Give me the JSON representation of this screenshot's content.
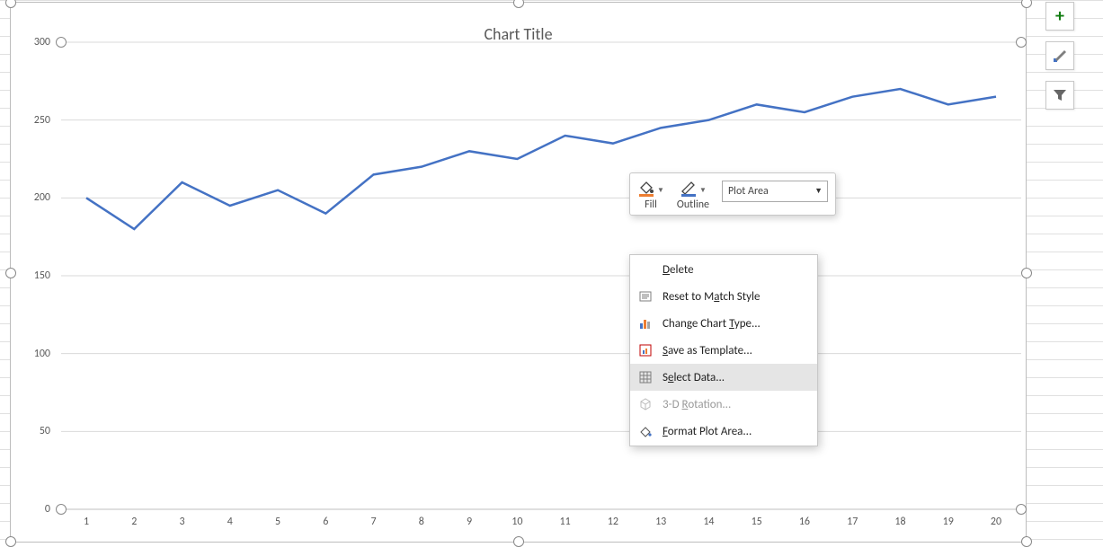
{
  "chart_data": {
    "type": "line",
    "title": "Chart Title",
    "xlabel": "",
    "ylabel": "",
    "ylim": [
      0,
      300
    ],
    "y_ticks": [
      0,
      50,
      100,
      150,
      200,
      250,
      300
    ],
    "categories": [
      "1",
      "2",
      "3",
      "4",
      "5",
      "6",
      "7",
      "8",
      "9",
      "10",
      "11",
      "12",
      "13",
      "14",
      "15",
      "16",
      "17",
      "18",
      "19",
      "20"
    ],
    "values": [
      200,
      180,
      210,
      195,
      205,
      190,
      215,
      220,
      230,
      225,
      240,
      235,
      245,
      250,
      260,
      255,
      265,
      270,
      260,
      265
    ]
  },
  "mini_toolbar": {
    "fill_label": "Fill",
    "outline_label": "Outline",
    "selector_value": "Plot Area"
  },
  "context_menu": {
    "items": [
      {
        "key": "delete",
        "label": "Delete",
        "underline_index": 0,
        "icon": "",
        "disabled": false
      },
      {
        "key": "reset",
        "label": "Reset to Match Style",
        "underline_index": 10,
        "icon": "reset-icon",
        "disabled": false
      },
      {
        "key": "change-type",
        "label": "Change Chart Type...",
        "underline_index": 13,
        "icon": "barchart-icon",
        "disabled": false
      },
      {
        "key": "save-tmpl",
        "label": "Save as Template...",
        "underline_index": 0,
        "icon": "savechart-icon",
        "disabled": false
      },
      {
        "key": "select-data",
        "label": "Select Data...",
        "underline_index": 1,
        "icon": "selectdata-icon",
        "disabled": false,
        "hover": true
      },
      {
        "key": "3d-rot",
        "label": "3-D Rotation...",
        "underline_index": 4,
        "icon": "cube-icon",
        "disabled": true
      },
      {
        "key": "format",
        "label": "Format Plot Area...",
        "underline_index": 0,
        "icon": "formatbucket-icon",
        "disabled": false
      }
    ]
  },
  "side_buttons": {
    "add": {
      "tooltip": "Chart Elements"
    },
    "style": {
      "tooltip": "Chart Styles"
    },
    "filter": {
      "tooltip": "Chart Filters"
    }
  }
}
